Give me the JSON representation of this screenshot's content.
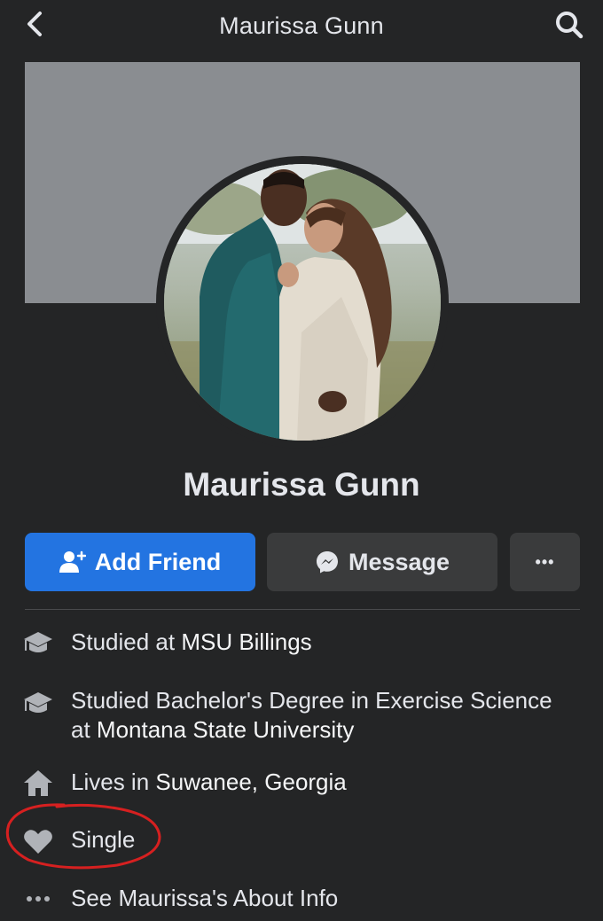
{
  "header": {
    "title": "Maurissa Gunn",
    "back_icon": "chevron-left-icon",
    "search_icon": "search-icon"
  },
  "profile": {
    "name": "Maurissa Gunn",
    "cover_color": "#8a8d91"
  },
  "actions": {
    "add_friend_label": "Add Friend",
    "message_label": "Message",
    "more_label": "•••"
  },
  "intro": {
    "items": [
      {
        "icon": "graduation-cap-icon",
        "prefix": "Studied at ",
        "highlight": "MSU Billings"
      },
      {
        "icon": "graduation-cap-icon",
        "prefix": "Studied Bachelor's Degree in Exercise Science at ",
        "highlight": "Montana State University"
      },
      {
        "icon": "home-icon",
        "prefix": "Lives in ",
        "highlight": "Suwanee, Georgia"
      },
      {
        "icon": "heart-icon",
        "prefix": "Single",
        "highlight": ""
      },
      {
        "icon": "more-dots-icon",
        "prefix": "See Maurissa's About Info",
        "highlight": ""
      }
    ]
  },
  "colors": {
    "background": "#242526",
    "primary_button": "#2374e1",
    "secondary_button": "#3a3b3c",
    "annotation": "#d62020"
  }
}
